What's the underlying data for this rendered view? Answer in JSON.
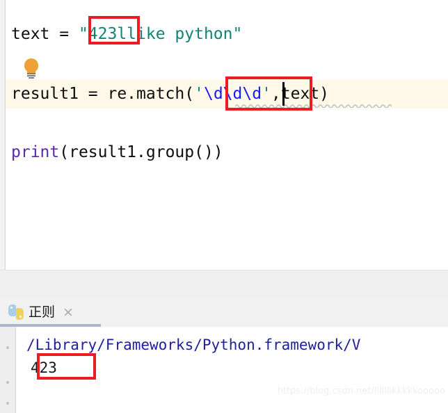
{
  "editor": {
    "lines": [
      {
        "id": "line-1",
        "segments": [
          {
            "text": "text = ",
            "kind": "default"
          },
          {
            "text": "\"423llike python\"",
            "kind": "string"
          }
        ]
      },
      {
        "id": "line-2",
        "segments": [
          {
            "text": "result1 = re.match(",
            "kind": "default"
          },
          {
            "text": "'",
            "kind": "string"
          },
          {
            "text": "\\d\\d\\d",
            "kind": "escape"
          },
          {
            "text": "'",
            "kind": "string"
          },
          {
            "text": ",text)",
            "kind": "default"
          }
        ]
      },
      {
        "id": "line-3",
        "segments": [
          {
            "text": "print",
            "kind": "builtin"
          },
          {
            "text": "(result1.group())",
            "kind": "default"
          }
        ]
      }
    ],
    "line1_plain": "text = \"423llike python\"",
    "line2_plain": "result1 = re.match('\\d\\d\\d',text)",
    "line3_plain": "print(result1.group())",
    "line1_prefix": "text = ",
    "line1_string": "\"423llike python\"",
    "line2_prefix": "result1 = re.match(",
    "line2_quote_open": "'",
    "line2_escape": "\\d\\d\\d",
    "line2_quote_close": "'",
    "line2_suffix": ",text)",
    "line3_builtin": "print",
    "line3_suffix": "(result1.group())",
    "intention_icon": "lightbulb-icon",
    "highlight_1_text": "423",
    "highlight_2_text": "'\\d\\d\\d'"
  },
  "console": {
    "tab": {
      "icon": "python-logo-icon",
      "label": "正则",
      "close_label": "×"
    },
    "path_line": "/Library/Frameworks/Python.framework/V",
    "output_line": "423",
    "toolstrip_icons": [
      "rerun-icon",
      "stop-icon",
      "trash-icon"
    ]
  },
  "watermark": {
    "text": "https://blog.csdn.net/lllllllkkkkkooooo"
  },
  "colors": {
    "string": "#0e8477",
    "escape": "#1a1aee",
    "builtin": "#5c29a8",
    "default": "#0d0d0d",
    "highlight_box": "#ec1c24",
    "current_line_bg": "#fdf8e8",
    "console_path": "#1f1f9e",
    "tab_underline": "#a9b6cc",
    "bulb": "#eea236"
  }
}
